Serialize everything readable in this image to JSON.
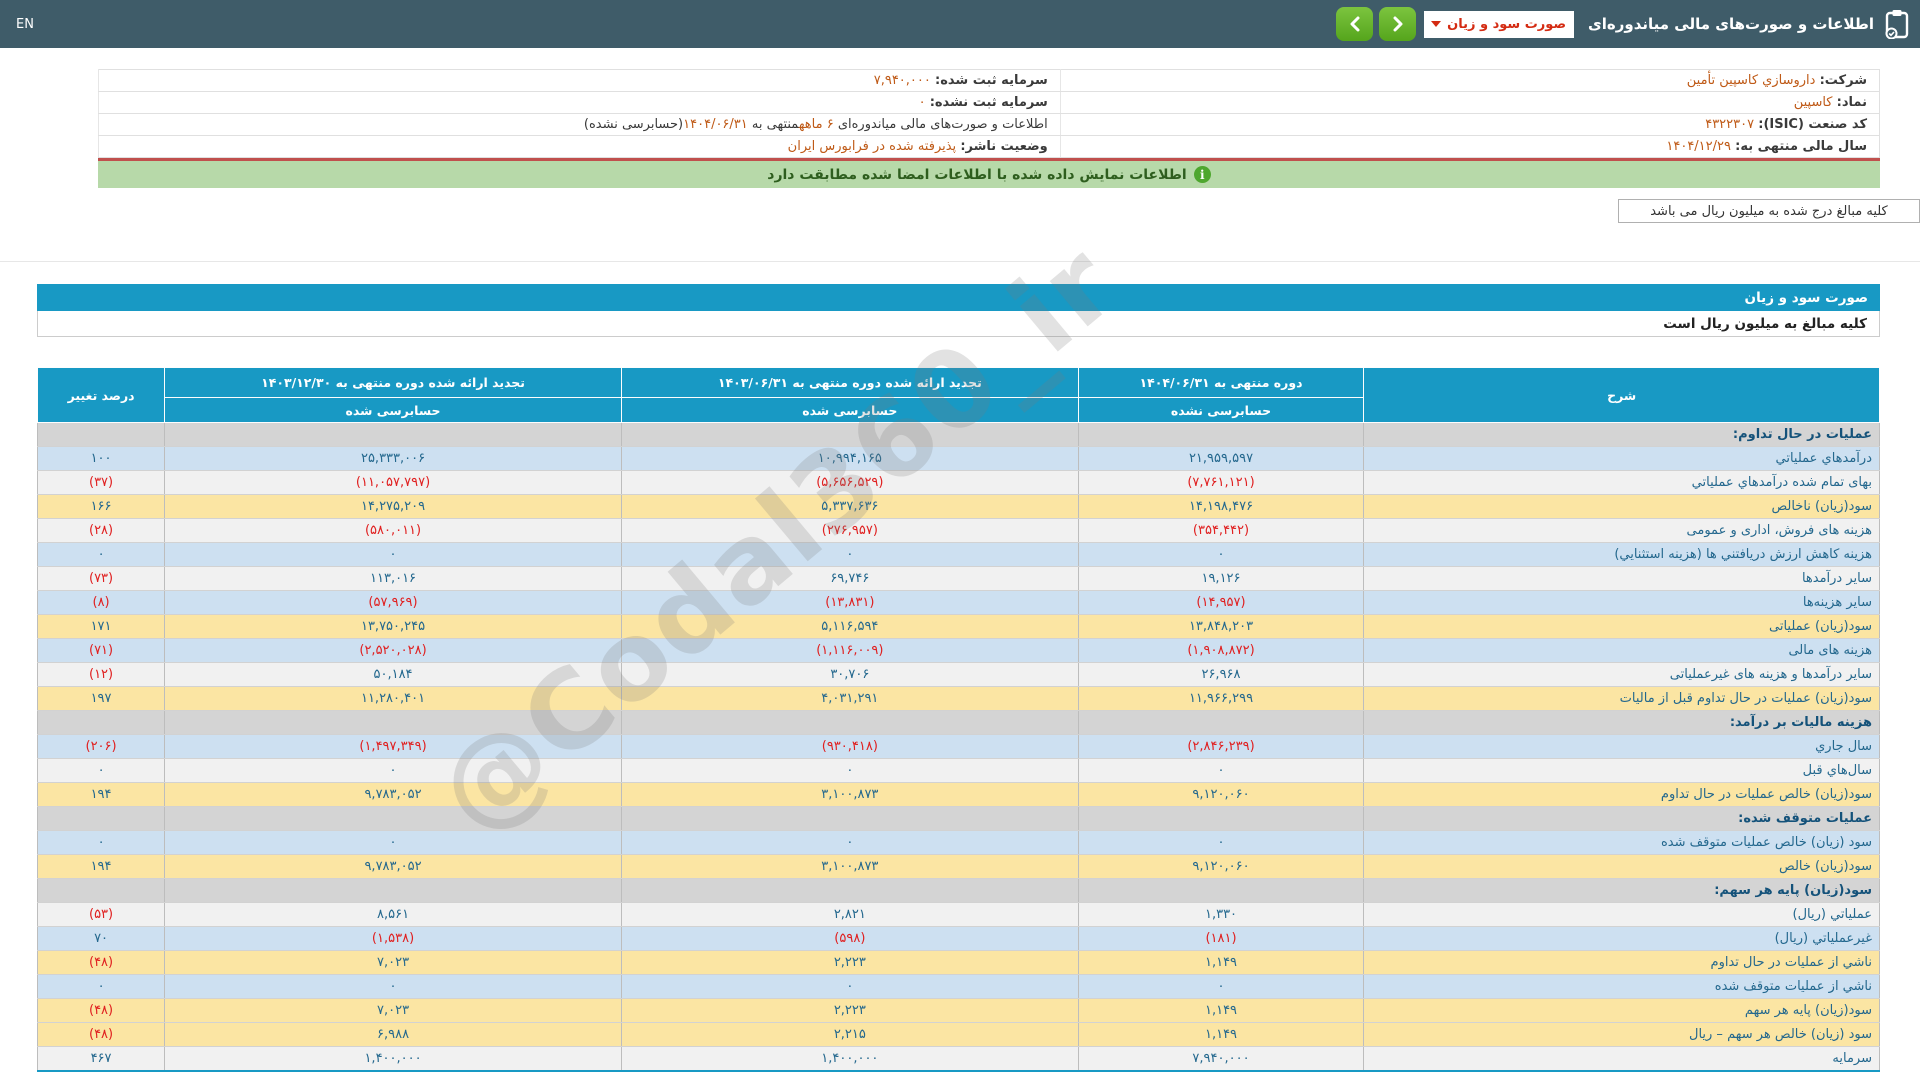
{
  "topbar": {
    "title": "اطلاعات و صورت‌های مالی میاندوره‌ای",
    "dropdown_value": "صورت سود و زیان",
    "en_label": "EN"
  },
  "company_info": {
    "rows": [
      {
        "right_label": "شرکت:",
        "right_value": "داروسازي کاسپین تأمین",
        "left_label": "سرمایه ثبت شده:",
        "left_value": "۷,۹۴۰,۰۰۰"
      },
      {
        "right_label": "نماد:",
        "right_value": "کاسپین",
        "left_label": "سرمایه ثبت نشده:",
        "left_value": "۰"
      },
      {
        "right_label": "کد صنعت (ISIC):",
        "right_value": "۴۳۲۲۳۰۷",
        "left_label": "",
        "left_value": ""
      },
      {
        "right_label": "سال مالی منتهی به:",
        "right_value": "۱۴۰۴/۱۲/۲۹",
        "left_label": "وضعیت ناشر:",
        "left_value": "پذیرفته شده در فرابورس ایران"
      }
    ],
    "period_parts": {
      "p1": "اطلاعات و صورت‌های مالی میاندوره‌ای ",
      "p2": "۶ ماهه",
      "p3": "منتهی به ",
      "p4": "۱۴۰۴/۰۶/۳۱",
      "p5": "(حسابرسی نشده)"
    }
  },
  "banner": {
    "text": "اطلاعات نمایش داده شده با اطلاعات امضا شده مطابقت دارد"
  },
  "note_box": {
    "text": "کلیه مبالغ درج شده به میلیون ریال می باشد"
  },
  "statement": {
    "title": "صورت سود و زیان",
    "unit_note": "کلیه مبالغ به میلیون ریال است",
    "header": {
      "desc": "شرح",
      "col1_l1": "دوره منتهی به ۱۴۰۴/۰۶/۳۱",
      "col1_l2": "حسابرسی نشده",
      "col2_l1": "تجدید ارائه شده دوره منتهی به ۱۴۰۳/۰۶/۳۱",
      "col2_l2": "حسابرسی شده",
      "col3_l1": "تجدید ارائه شده دوره منتهی به ۱۴۰۳/۱۲/۳۰",
      "col3_l2": "حسابرسی شده",
      "pct": "درصد تغییر"
    },
    "rows": [
      {
        "label": "عملیات در حال تداوم:",
        "bg": "section",
        "v1": "",
        "v2": "",
        "v3": "",
        "pct": ""
      },
      {
        "label": "درآمدهاي عملیاتي",
        "bg": "blue",
        "v1": "۲۱,۹۵۹,۵۹۷",
        "v2": "۱۰,۹۹۴,۱۶۵",
        "v3": "۲۵,۳۳۳,۰۰۶",
        "pct": "۱۰۰"
      },
      {
        "label": "بهای تمام شده درآمدهاي عملیاتي",
        "bg": "white",
        "v1": "(۷,۷۶۱,۱۲۱)",
        "v2": "(۵,۶۵۶,۵۲۹)",
        "v3": "(۱۱,۰۵۷,۷۹۷)",
        "pct": "(۳۷)"
      },
      {
        "label": "سود(زیان) ناخالص",
        "bg": "yellow",
        "v1": "۱۴,۱۹۸,۴۷۶",
        "v2": "۵,۳۳۷,۶۳۶",
        "v3": "۱۴,۲۷۵,۲۰۹",
        "pct": "۱۶۶"
      },
      {
        "label": "هزینه های فروش، اداری و عمومی",
        "bg": "white",
        "v1": "(۳۵۴,۴۴۲)",
        "v2": "(۲۷۶,۹۵۷)",
        "v3": "(۵۸۰,۰۱۱)",
        "pct": "(۲۸)"
      },
      {
        "label": "هزینه کاهش ارزش دریافتني ها (هزینه استثنایي)",
        "bg": "blue",
        "v1": "۰",
        "v2": "۰",
        "v3": "۰",
        "pct": "۰"
      },
      {
        "label": "سایر درآمدها",
        "bg": "white",
        "v1": "۱۹,۱۲۶",
        "v2": "۶۹,۷۴۶",
        "v3": "۱۱۳,۰۱۶",
        "pct": "(۷۳)"
      },
      {
        "label": "سایر هزینه‌ها",
        "bg": "blue",
        "v1": "(۱۴,۹۵۷)",
        "v2": "(۱۳,۸۳۱)",
        "v3": "(۵۷,۹۶۹)",
        "pct": "(۸)"
      },
      {
        "label": "سود(زیان) عملیاتی",
        "bg": "yellow",
        "v1": "۱۳,۸۴۸,۲۰۳",
        "v2": "۵,۱۱۶,۵۹۴",
        "v3": "۱۳,۷۵۰,۲۴۵",
        "pct": "۱۷۱"
      },
      {
        "label": "هزینه های مالی",
        "bg": "blue",
        "v1": "(۱,۹۰۸,۸۷۲)",
        "v2": "(۱,۱۱۶,۰۰۹)",
        "v3": "(۲,۵۲۰,۰۲۸)",
        "pct": "(۷۱)"
      },
      {
        "label": "سایر درآمدها و هزینه های غیرعملیاتی",
        "bg": "white",
        "v1": "۲۶,۹۶۸",
        "v2": "۳۰,۷۰۶",
        "v3": "۵۰,۱۸۴",
        "pct": "(۱۲)"
      },
      {
        "label": "سود(زیان) عملیات در حال تداوم قبل از مالیات",
        "bg": "yellow",
        "v1": "۱۱,۹۶۶,۲۹۹",
        "v2": "۴,۰۳۱,۲۹۱",
        "v3": "۱۱,۲۸۰,۴۰۱",
        "pct": "۱۹۷"
      },
      {
        "label": "هزینه مالیات بر درآمد:",
        "bg": "section",
        "v1": "",
        "v2": "",
        "v3": "",
        "pct": ""
      },
      {
        "label": "سال جاري",
        "bg": "blue",
        "v1": "(۲,۸۴۶,۲۳۹)",
        "v2": "(۹۳۰,۴۱۸)",
        "v3": "(۱,۴۹۷,۳۴۹)",
        "pct": "(۲۰۶)"
      },
      {
        "label": "سال‌هاي قبل",
        "bg": "white",
        "v1": "۰",
        "v2": "۰",
        "v3": "۰",
        "pct": "۰"
      },
      {
        "label": "سود(زیان) خالص عملیات در حال تداوم",
        "bg": "yellow",
        "v1": "۹,۱۲۰,۰۶۰",
        "v2": "۳,۱۰۰,۸۷۳",
        "v3": "۹,۷۸۳,۰۵۲",
        "pct": "۱۹۴"
      },
      {
        "label": "عملیات متوقف شده:",
        "bg": "section",
        "v1": "",
        "v2": "",
        "v3": "",
        "pct": ""
      },
      {
        "label": "سود (زیان) خالص عملیات متوقف شده",
        "bg": "blue",
        "v1": "۰",
        "v2": "۰",
        "v3": "۰",
        "pct": "۰"
      },
      {
        "label": "سود(زیان) خالص",
        "bg": "yellow",
        "v1": "۹,۱۲۰,۰۶۰",
        "v2": "۳,۱۰۰,۸۷۳",
        "v3": "۹,۷۸۳,۰۵۲",
        "pct": "۱۹۴"
      },
      {
        "label": "سود(زیان) پایه هر سهم:",
        "bg": "section",
        "v1": "",
        "v2": "",
        "v3": "",
        "pct": ""
      },
      {
        "label": "عملیاتي (ریال)",
        "bg": "white",
        "v1": "۱,۳۳۰",
        "v2": "۲,۸۲۱",
        "v3": "۸,۵۶۱",
        "pct": "(۵۳)"
      },
      {
        "label": "غیرعملیاتي (ریال)",
        "bg": "blue",
        "v1": "(۱۸۱)",
        "v2": "(۵۹۸)",
        "v3": "(۱,۵۳۸)",
        "pct": "۷۰"
      },
      {
        "label": "ناشي از عملیات در حال تداوم",
        "bg": "yellow",
        "v1": "۱,۱۴۹",
        "v2": "۲,۲۲۳",
        "v3": "۷,۰۲۳",
        "pct": "(۴۸)"
      },
      {
        "label": "ناشي از عملیات متوقف شده",
        "bg": "blue",
        "v1": "۰",
        "v2": "۰",
        "v3": "۰",
        "pct": "۰"
      },
      {
        "label": "سود(زیان) پایه هر سهم",
        "bg": "yellow",
        "v1": "۱,۱۴۹",
        "v2": "۲,۲۲۳",
        "v3": "۷,۰۲۳",
        "pct": "(۴۸)"
      },
      {
        "label": "سود (زیان) خالص هر سهم – ریال",
        "bg": "yellow",
        "v1": "۱,۱۴۹",
        "v2": "۲,۲۱۵",
        "v3": "۶,۹۸۸",
        "pct": "(۴۸)"
      },
      {
        "label": "سرمایه",
        "bg": "white",
        "v1": "۷,۹۴۰,۰۰۰",
        "v2": "۱,۴۰۰,۰۰۰",
        "v3": "۱,۴۰۰,۰۰۰",
        "pct": "۴۶۷"
      }
    ]
  },
  "watermark": "@Codal360_ir",
  "colors": {
    "topbar": "#3f5c69",
    "accent_blue": "#1899c4",
    "row_blue": "#cde0f1",
    "row_yellow": "#fbe5a3",
    "row_gray": "#d4d4d4",
    "negative_red": "#e02020",
    "value_orange": "#bf5a17",
    "banner_green": "#b7d9a9",
    "nav_green": "#66b52e",
    "dropdown_red": "#d42b12"
  }
}
